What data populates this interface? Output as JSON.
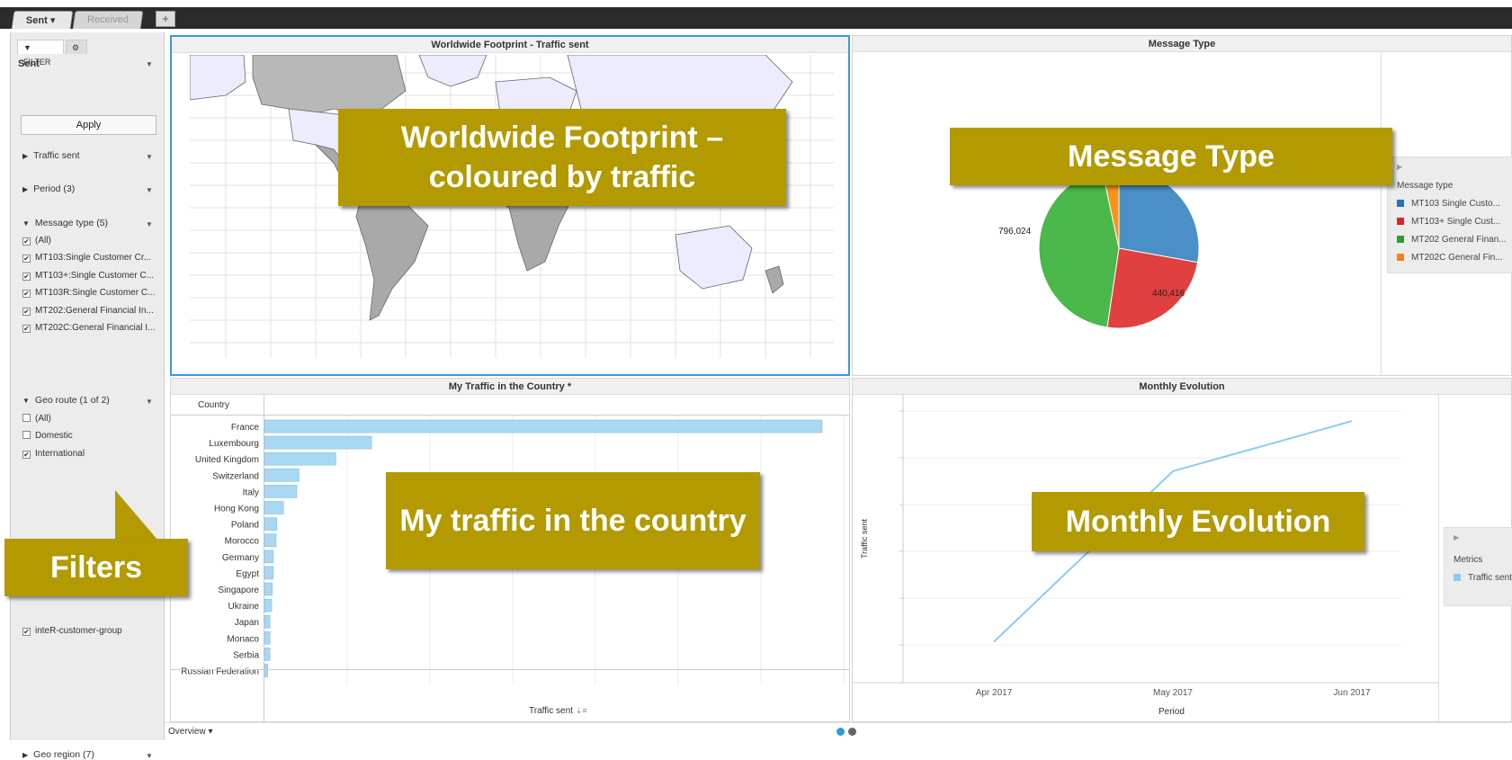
{
  "tabs": [
    {
      "label": "Sent",
      "active": true
    },
    {
      "label": "Received",
      "active": false
    }
  ],
  "tab_add_label": "+",
  "sidebar": {
    "filter_tab": "FILTER",
    "selector_value": "Sent",
    "apply_label": "Apply",
    "sections": {
      "traffic": "Traffic sent",
      "period": "Period (3)",
      "message_type": "Message type (5)",
      "geo_route": "Geo route (1 of 2)",
      "geo_region": "Geo region (7)"
    },
    "message_type_items": [
      {
        "label": "(All)",
        "checked": true
      },
      {
        "label": "MT103:Single Customer Cr...",
        "checked": true
      },
      {
        "label": "MT103+:Single Customer C...",
        "checked": true
      },
      {
        "label": "MT103R:Single Customer C...",
        "checked": true
      },
      {
        "label": "MT202:General Financial In...",
        "checked": true
      },
      {
        "label": "MT202C:General Financial I...",
        "checked": true
      }
    ],
    "geo_route_items": [
      {
        "label": "(All)",
        "checked": false
      },
      {
        "label": "Domestic",
        "checked": false
      },
      {
        "label": "International",
        "checked": true
      }
    ],
    "customer_group_item": {
      "label": "inteR-customer-group",
      "checked": true
    }
  },
  "panels": {
    "map": {
      "title": "Worldwide Footprint - Traffic sent"
    },
    "message_type": {
      "title": "Message Type",
      "legend_title": "Message type",
      "legend_items": [
        {
          "label": "MT103 Single Custo...",
          "color": "#1f77b4"
        },
        {
          "label": "MT103+ Single Cust...",
          "color": "#d62728"
        },
        {
          "label": "MT202 General Finan...",
          "color": "#2ca02c"
        },
        {
          "label": "MT202C General Fin...",
          "color": "#ff7f0e"
        }
      ],
      "labels": {
        "left": "796,024",
        "bottom": "440,416"
      }
    },
    "country": {
      "title": "My Traffic in the Country *",
      "column_header": "Country",
      "axis_label": "Traffic sent",
      "axis_sort_icon": "⇣≡"
    },
    "monthly": {
      "title": "Monthly Evolution",
      "y_label": "Traffic sent",
      "x_label": "Period",
      "legend_title": "Metrics",
      "legend_item": "Traffic sent"
    }
  },
  "chart_data": [
    {
      "type": "pie",
      "title": "Message Type",
      "slices": [
        {
          "label": "MT103 Single Custo...",
          "value": 500000,
          "color": "#4a90c6"
        },
        {
          "label": "MT103+ Single Cust...",
          "value": 440416,
          "color": "#e04040"
        },
        {
          "label": "MT202 General Finan...",
          "value": 796024,
          "color": "#4ab84a"
        },
        {
          "label": "MT202C General Fin...",
          "value": 60000,
          "color": "#f7941d"
        }
      ]
    },
    {
      "type": "bar",
      "orientation": "horizontal",
      "title": "My Traffic in the Country *",
      "categories": [
        "France",
        "Luxembourg",
        "United Kingdom",
        "Switzerland",
        "Italy",
        "Hong Kong",
        "Poland",
        "Morocco",
        "Germany",
        "Egypt",
        "Singapore",
        "Ukraine",
        "Japan",
        "Monaco",
        "Serbia",
        "Russian Federation"
      ],
      "values": [
        100,
        19.2,
        12.8,
        6.2,
        5.8,
        3.4,
        2.2,
        2.1,
        1.6,
        1.6,
        1.4,
        1.3,
        1.0,
        1.0,
        1.0,
        0.6
      ],
      "xlabel": "Traffic sent",
      "color": "#a8d8f2"
    },
    {
      "type": "line",
      "title": "Monthly Evolution",
      "x": [
        "Apr 2017",
        "May 2017",
        "Jun 2017"
      ],
      "series": [
        {
          "name": "Traffic sent",
          "values": [
            0.12,
            0.8,
            1.0
          ]
        }
      ],
      "xlabel": "Period",
      "ylabel": "Traffic sent",
      "color": "#87ceeb"
    }
  ],
  "callouts": {
    "map": "Worldwide Footprint – coloured by traffic",
    "message": "Message Type",
    "country": "My traffic in the country",
    "monthly": "Monthly Evolution",
    "filters": "Filters"
  },
  "footer": {
    "page_label": "Overview"
  }
}
